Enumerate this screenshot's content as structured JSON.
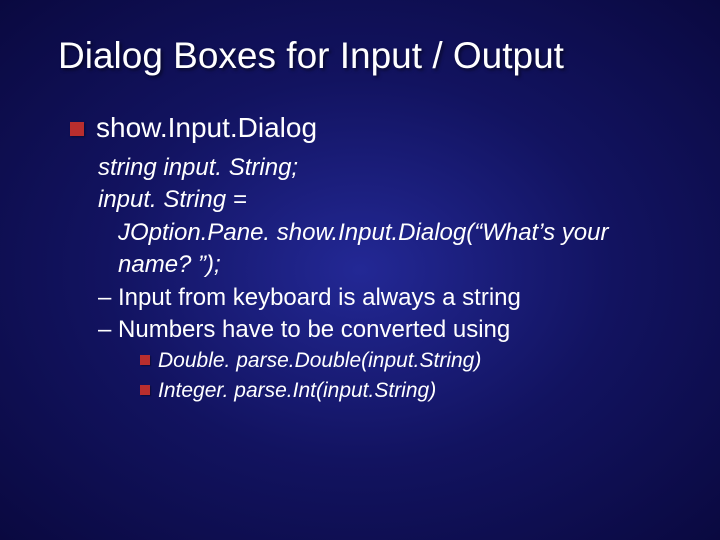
{
  "title": "Dialog Boxes for Input / Output",
  "heading1": "show.Input.Dialog",
  "code1": "string input. String;",
  "code2": "input. String =",
  "code3": "JOption.Pane. show.Input.Dialog(“What’s your name? ”);",
  "dash1": "– Input from keyboard is always a string",
  "dash2": "– Numbers have to be converted using",
  "sub1": "Double. parse.Double(input.String)",
  "sub2": "Integer. parse.Int(input.String)"
}
